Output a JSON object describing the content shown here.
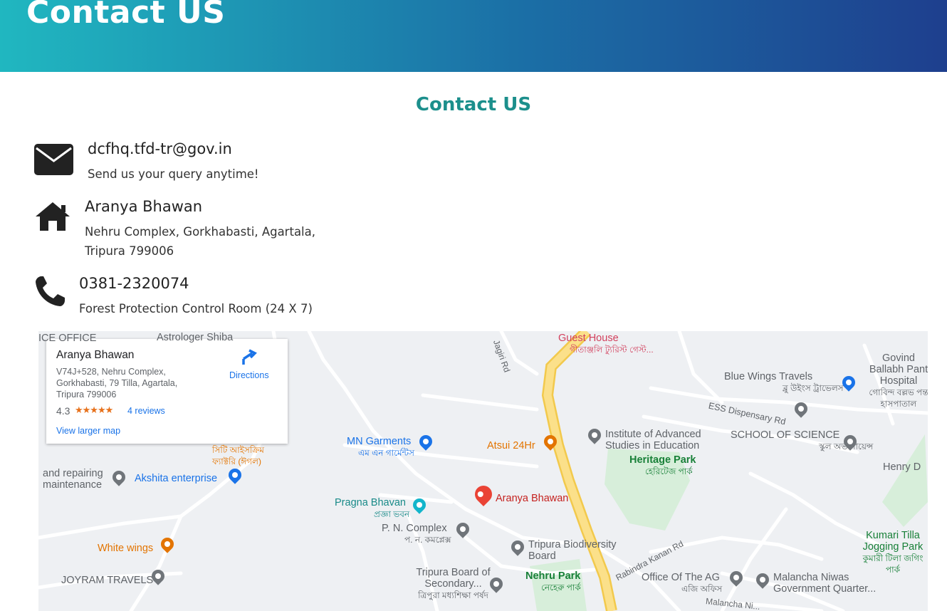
{
  "hero": {
    "title": "Contact US"
  },
  "section": {
    "title": "Contact US"
  },
  "contacts": {
    "email": {
      "title": "dcfhq.tfd-tr@gov.in",
      "desc": "Send us your query anytime!"
    },
    "address": {
      "title": "Aranya Bhawan",
      "line1": "Nehru Complex, Gorkhabasti, Agartala,",
      "line2": "Tripura 799006"
    },
    "phone": {
      "title": "0381-2320074",
      "desc": "Forest Protection Control Room (24 X 7)"
    }
  },
  "map": {
    "card": {
      "title": "Aranya Bhawan",
      "address": "V74J+528, Nehru Complex, Gorkhabasti, 79 Tilla, Agartala, Tripura 799006",
      "rating": "4.3",
      "stars": "★★★★★",
      "reviews": "4 reviews",
      "larger_map": "View larger map",
      "directions": "Directions"
    },
    "places": {
      "guest_house": "Guest House",
      "guest_house_bn": "গীতাঞ্জলি ট্যুরিস্ট গেস্ট...",
      "govind": "Govind Ballabh Pant Hospital",
      "govind_bn": "গোবিন্দ বল্লভ পন্ত হাসপাতাল",
      "blue_wings": "Blue Wings Travels",
      "blue_wings_bn": "ব্লু উইংস ট্রাভেলস",
      "ess_road": "ESS Dispensary Rd",
      "school": "SCHOOL OF SCIENCE",
      "school_bn": "স্কুল অভ সায়েন্স",
      "institute": "Institute of Advanced Studies in Education",
      "heritage": "Heritage Park",
      "heritage_bn": "হেরিটেজ পার্ক",
      "mn_garments": "MN Garments",
      "mn_garments_bn": "এম এন গার্মেন্টস",
      "atsui": "Atsui 24Hr",
      "aranya_pin": "Aranya Bhawan",
      "pragna": "Pragna Bhavan",
      "pragna_bn": "প্রজ্ঞা ভবন",
      "pn_complex": "P. N. Complex",
      "pn_complex_bn": "প. ন. কমপ্লেক্স",
      "biodiversity": "Tripura Biodiversity Board",
      "nehru_park": "Nehru Park",
      "nehru_park_bn": "নেহেরু পার্ক",
      "board": "Tripura Board of Secondary...",
      "board_bn": "ত্রিপুরা মধ্যশিক্ষা পর্ষদ",
      "ag_office": "Office Of The AG",
      "ag_office_bn": "এজি অফিস",
      "malancha": "Malancha Niwas Government Quarter...",
      "kumari": "Kumari Tilla Jogging Park",
      "kumari_bn": "কুমারী টিলা জগিং পার্ক",
      "henry": "Henry D",
      "akshita": "Akshita enterprise",
      "repairing": "and repairing maintenance",
      "white_wings": "White wings",
      "joyram": "JOYRAM TRAVELS",
      "astrologer": "Astrologer Shiba",
      "ice_office": "ICE OFFICE",
      "eagle_bn": "সিটি আইসক্রিম ফ্যাক্টরি (ঈগল)",
      "jagiri_rd": "Jagiri Rd",
      "rabindra_rd": "Rabindra Kanan Rd",
      "malancha_rd": "Malancha Ni..."
    }
  }
}
